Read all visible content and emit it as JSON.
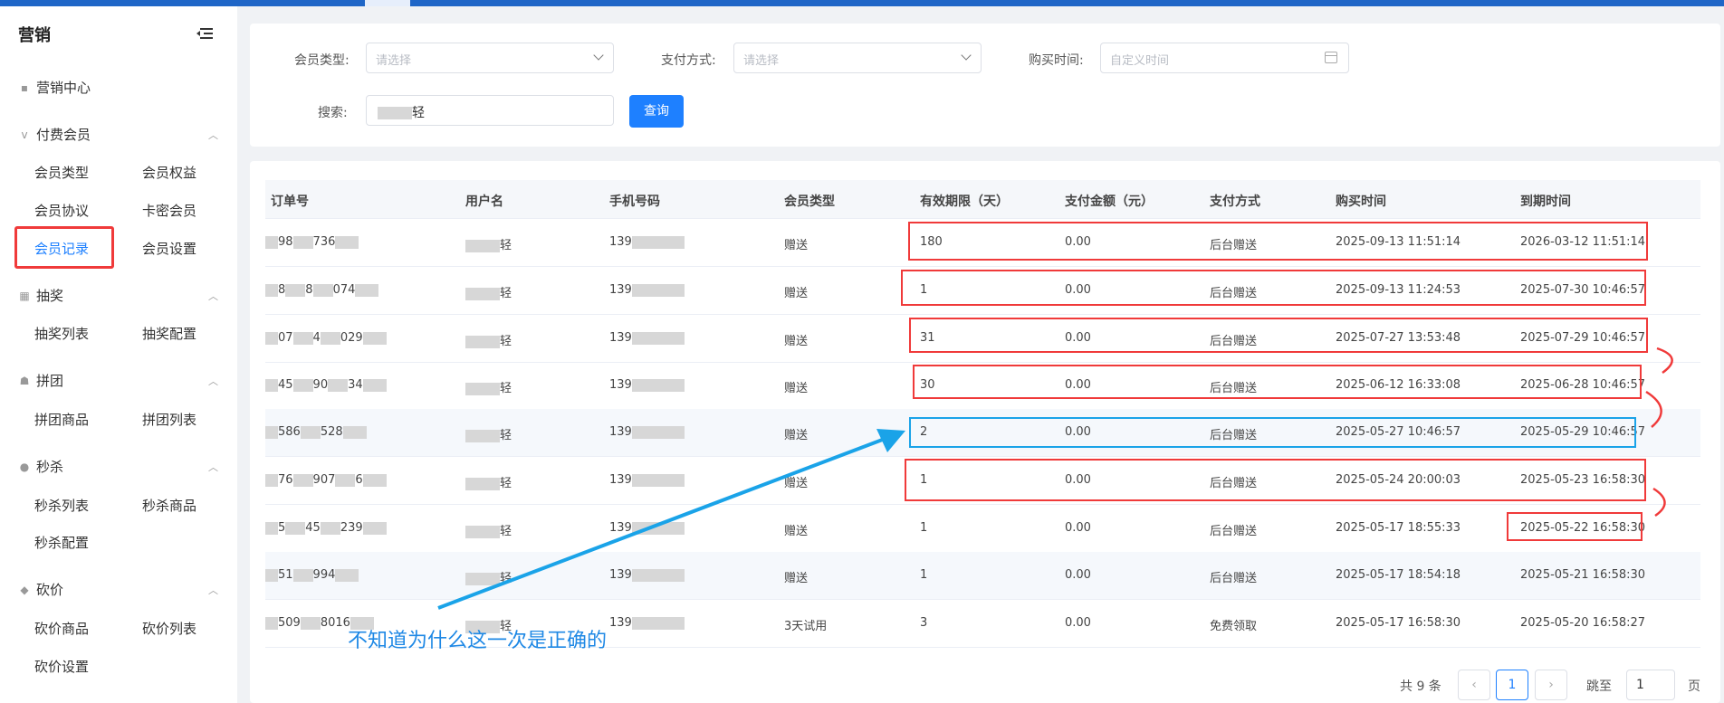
{
  "sidebar": {
    "title": "营销",
    "collapse_icon": "menu-fold-icon",
    "marketing_center": "营销中心",
    "groups": {
      "paid_member": {
        "label": "付费会员",
        "items": [
          "会员类型",
          "会员权益",
          "会员协议",
          "卡密会员",
          "会员记录",
          "会员设置"
        ]
      },
      "lottery": {
        "label": "抽奖",
        "items": [
          "抽奖列表",
          "抽奖配置"
        ]
      },
      "group_buy": {
        "label": "拼团",
        "items": [
          "拼团商品",
          "拼团列表"
        ]
      },
      "seckill": {
        "label": "秒杀",
        "items": [
          "秒杀列表",
          "秒杀商品",
          "秒杀配置"
        ]
      },
      "bargain": {
        "label": "砍价",
        "items": [
          "砍价商品",
          "砍价列表",
          "砍价设置"
        ]
      }
    }
  },
  "filter": {
    "member_type_label": "会员类型:",
    "member_type_placeholder": "请选择",
    "pay_method_label": "支付方式:",
    "pay_method_placeholder": "请选择",
    "buy_time_label": "购买时间:",
    "buy_time_placeholder": "自定义时间",
    "search_label": "搜索:",
    "search_value_tail": "轻",
    "query_button": "查询"
  },
  "table": {
    "columns": [
      "订单号",
      "用户名",
      "手机号码",
      "会员类型",
      "有效期限（天）",
      "支付金额（元）",
      "支付方式",
      "购买时间",
      "到期时间"
    ],
    "rows": [
      {
        "order": [
          "98",
          "736"
        ],
        "user_tail": "轻",
        "phone_prefix": "139",
        "type": "赠送",
        "days": "180",
        "amount": "0.00",
        "pay": "后台赠送",
        "buy": "2025-09-13 11:51:14",
        "expire": "2026-03-12 11:51:14"
      },
      {
        "order": [
          "8",
          "8",
          "074"
        ],
        "user_tail": "轻",
        "phone_prefix": "139",
        "type": "赠送",
        "days": "1",
        "amount": "0.00",
        "pay": "后台赠送",
        "buy": "2025-09-13 11:24:53",
        "expire": "2025-07-30 10:46:57"
      },
      {
        "order": [
          "07",
          "4",
          "029"
        ],
        "user_tail": "轻",
        "phone_prefix": "139",
        "type": "赠送",
        "days": "31",
        "amount": "0.00",
        "pay": "后台赠送",
        "buy": "2025-07-27 13:53:48",
        "expire": "2025-07-29 10:46:57"
      },
      {
        "order": [
          "45",
          "90",
          "34"
        ],
        "user_tail": "轻",
        "phone_prefix": "139",
        "type": "赠送",
        "days": "30",
        "amount": "0.00",
        "pay": "后台赠送",
        "buy": "2025-06-12 16:33:08",
        "expire": "2025-06-28 10:46:57"
      },
      {
        "order": [
          "586",
          "528"
        ],
        "user_tail": "轻",
        "phone_prefix": "139",
        "type": "赠送",
        "days": "2",
        "amount": "0.00",
        "pay": "后台赠送",
        "buy": "2025-05-27 10:46:57",
        "expire": "2025-05-29 10:46:57"
      },
      {
        "order": [
          "76",
          "907",
          "6"
        ],
        "user_tail": "轻",
        "phone_prefix": "139",
        "type": "赠送",
        "days": "1",
        "amount": "0.00",
        "pay": "后台赠送",
        "buy": "2025-05-24 20:00:03",
        "expire": "2025-05-23 16:58:30"
      },
      {
        "order": [
          "5",
          "45",
          "239"
        ],
        "user_tail": "轻",
        "phone_prefix": "139",
        "type": "赠送",
        "days": "1",
        "amount": "0.00",
        "pay": "后台赠送",
        "buy": "2025-05-17 18:55:33",
        "expire": "2025-05-22 16:58:30"
      },
      {
        "order": [
          "51",
          "994"
        ],
        "user_tail": "轻",
        "phone_prefix": "139",
        "type": "赠送",
        "days": "1",
        "amount": "0.00",
        "pay": "后台赠送",
        "buy": "2025-05-17 18:54:18",
        "expire": "2025-05-21 16:58:30"
      },
      {
        "order": [
          "509",
          "8016"
        ],
        "user_tail": "轻",
        "phone_prefix": "139",
        "type": "3天试用",
        "days": "3",
        "amount": "0.00",
        "pay": "免费领取",
        "buy": "2025-05-17 16:58:30",
        "expire": "2025-05-20 16:58:27"
      }
    ]
  },
  "annotation_text": "不知道为什么这一次是正确的",
  "annotation_colors": {
    "red": "#f03a3a",
    "blue": "#1aa3e8"
  },
  "pagination": {
    "total": "共 9 条",
    "prev_icon": "chevron-left-icon",
    "current": "1",
    "next_icon": "chevron-right-icon",
    "jump_label": "跳至",
    "jump_value": "1",
    "unit": "页"
  }
}
